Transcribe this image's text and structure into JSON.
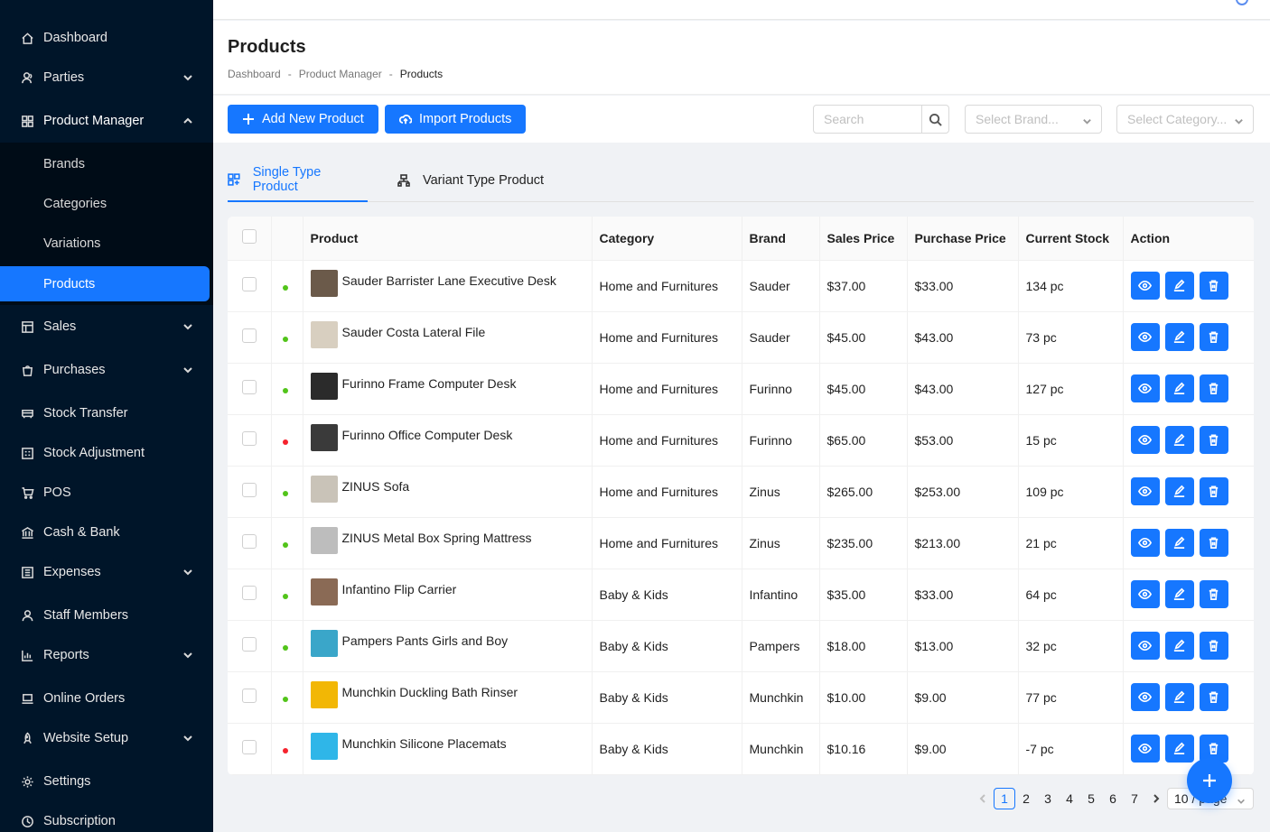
{
  "sidebar": {
    "items": [
      {
        "label": "Dashboard",
        "icon": "home-icon",
        "chevron": ""
      },
      {
        "label": "Parties",
        "icon": "users-icon",
        "chevron": "down"
      },
      {
        "label": "Product Manager",
        "icon": "grid-icon",
        "chevron": "up"
      },
      {
        "label": "Sales",
        "icon": "sales-icon",
        "chevron": "down"
      },
      {
        "label": "Purchases",
        "icon": "bag-icon",
        "chevron": "down"
      },
      {
        "label": "Stock Transfer",
        "icon": "truck-icon",
        "chevron": ""
      },
      {
        "label": "Stock Adjustment",
        "icon": "adjust-icon",
        "chevron": ""
      },
      {
        "label": "POS",
        "icon": "cart-icon",
        "chevron": ""
      },
      {
        "label": "Cash & Bank",
        "icon": "bank-icon",
        "chevron": ""
      },
      {
        "label": "Expenses",
        "icon": "expense-icon",
        "chevron": "down"
      },
      {
        "label": "Staff Members",
        "icon": "user-icon",
        "chevron": ""
      },
      {
        "label": "Reports",
        "icon": "chart-icon",
        "chevron": "down"
      },
      {
        "label": "Online Orders",
        "icon": "laptop-icon",
        "chevron": ""
      },
      {
        "label": "Website Setup",
        "icon": "rocket-icon",
        "chevron": "down"
      },
      {
        "label": "Settings",
        "icon": "gear-icon",
        "chevron": ""
      },
      {
        "label": "Subscription",
        "icon": "subscription-icon",
        "chevron": ""
      }
    ],
    "submenu": [
      "Brands",
      "Categories",
      "Variations",
      "Products"
    ],
    "active_sub": "Products"
  },
  "header": {
    "title": "Products",
    "breadcrumb": [
      "Dashboard",
      "Product Manager",
      "Products"
    ],
    "separator": "-"
  },
  "toolbar": {
    "add_label": "Add New Product",
    "import_label": "Import Products",
    "search_placeholder": "Search",
    "brand_placeholder": "Select Brand...",
    "category_placeholder": "Select Category..."
  },
  "tabs": [
    {
      "label": "Single Type Product",
      "active": true
    },
    {
      "label": "Variant Type Product",
      "active": false
    }
  ],
  "table": {
    "columns": [
      "Product",
      "Category",
      "Brand",
      "Sales Price",
      "Purchase Price",
      "Current Stock",
      "Action"
    ],
    "rows": [
      {
        "name": "Sauder Barrister Lane Executive Desk",
        "category": "Home and Furnitures",
        "brand": "Sauder",
        "sales": "$37.00",
        "purchase": "$33.00",
        "stock": "134 pc",
        "status": "green",
        "thumb": "#6b5a4a"
      },
      {
        "name": "Sauder Costa Lateral File",
        "category": "Home and Furnitures",
        "brand": "Sauder",
        "sales": "$45.00",
        "purchase": "$43.00",
        "stock": "73 pc",
        "status": "green",
        "thumb": "#d8cfc0"
      },
      {
        "name": "Furinno Frame Computer Desk",
        "category": "Home and Furnitures",
        "brand": "Furinno",
        "sales": "$45.00",
        "purchase": "$43.00",
        "stock": "127 pc",
        "status": "green",
        "thumb": "#2b2b2b"
      },
      {
        "name": "Furinno Office Computer Desk",
        "category": "Home and Furnitures",
        "brand": "Furinno",
        "sales": "$65.00",
        "purchase": "$53.00",
        "stock": "15 pc",
        "status": "red",
        "thumb": "#3a3a3a"
      },
      {
        "name": "ZINUS Sofa",
        "category": "Home and Furnitures",
        "brand": "Zinus",
        "sales": "$265.00",
        "purchase": "$253.00",
        "stock": "109 pc",
        "status": "green",
        "thumb": "#c9c3b8"
      },
      {
        "name": "ZINUS Metal Box Spring Mattress",
        "category": "Home and Furnitures",
        "brand": "Zinus",
        "sales": "$235.00",
        "purchase": "$213.00",
        "stock": "21 pc",
        "status": "green",
        "thumb": "#bdbdbd"
      },
      {
        "name": "Infantino Flip Carrier",
        "category": "Baby & Kids",
        "brand": "Infantino",
        "sales": "$35.00",
        "purchase": "$33.00",
        "stock": "64 pc",
        "status": "green",
        "thumb": "#8a6a55"
      },
      {
        "name": "Pampers Pants Girls and Boy",
        "category": "Baby & Kids",
        "brand": "Pampers",
        "sales": "$18.00",
        "purchase": "$13.00",
        "stock": "32 pc",
        "status": "green",
        "thumb": "#3aa6c9"
      },
      {
        "name": "Munchkin Duckling Bath Rinser",
        "category": "Baby & Kids",
        "brand": "Munchkin",
        "sales": "$10.00",
        "purchase": "$9.00",
        "stock": "77 pc",
        "status": "green",
        "thumb": "#f2b705"
      },
      {
        "name": "Munchkin Silicone Placemats",
        "category": "Baby & Kids",
        "brand": "Munchkin",
        "sales": "$10.16",
        "purchase": "$9.00",
        "stock": "-7 pc",
        "status": "red",
        "thumb": "#2fb6e8"
      }
    ]
  },
  "pagination": {
    "pages": [
      "1",
      "2",
      "3",
      "4",
      "5",
      "6",
      "7"
    ],
    "current": "1",
    "page_size": "10 / page"
  },
  "colors": {
    "accent": "#1677ff",
    "sidebar_bg": "#001529",
    "status_green": "#52c41a",
    "status_red": "#f5222d"
  }
}
